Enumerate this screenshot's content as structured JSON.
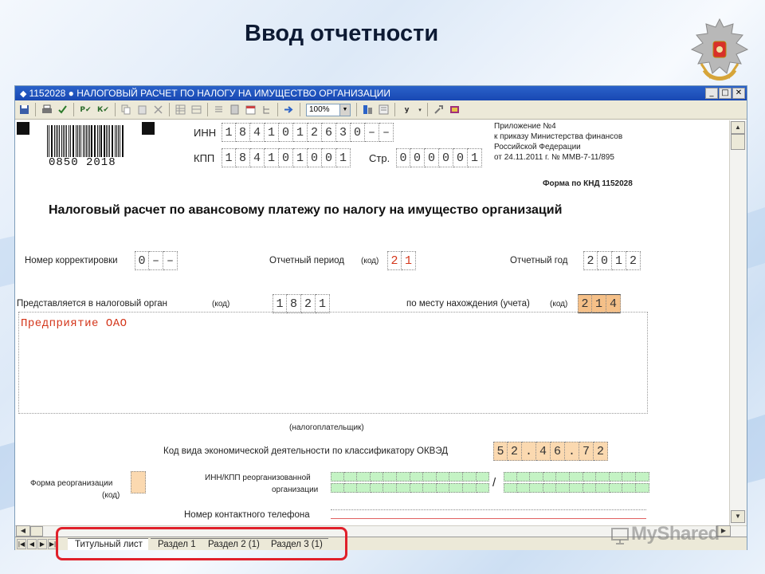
{
  "slide": {
    "title": "Ввод отчетности",
    "watermark": "MyShared"
  },
  "window": {
    "title": "1152028 ● НАЛОГОВЫЙ РАСЧЕТ ПО НАЛОГУ НА ИМУЩЕСТВО ОРГАНИЗАЦИИ",
    "buttons": [
      "_",
      "□",
      "✕"
    ],
    "zoom": "100%"
  },
  "toolbar": {
    "items": [
      "save-icon",
      "print-icon",
      "check-icon",
      "Р✔",
      "К✔",
      "copy-icon",
      "paste-icon",
      "delete-icon",
      "table-icon",
      "arrow-right-icon",
      "filter-icon",
      "у",
      "settings-icon",
      "book-icon"
    ],
    "text_buttons": [
      "Р✔",
      "К✔",
      "у"
    ]
  },
  "form": {
    "barcode_number": "0850 2018",
    "inn_label": "ИНН",
    "inn_cells": [
      "1",
      "8",
      "4",
      "1",
      "0",
      "1",
      "2",
      "6",
      "3",
      "0",
      "–",
      "–"
    ],
    "kpp_label": "КПП",
    "kpp_cells": [
      "1",
      "8",
      "4",
      "1",
      "0",
      "1",
      "0",
      "0",
      "1"
    ],
    "page_label": "Стр.",
    "page_cells": [
      "0",
      "0",
      "0",
      "0",
      "0",
      "1"
    ],
    "appendix": [
      "Приложение №4",
      "к приказу Министерства финансов",
      "Российской Федерации",
      "от 24.11.2011 г. № ММВ-7-11/895"
    ],
    "form_code": "Форма по КНД 1152028",
    "heading": "Налоговый расчет по авансовому платежу по налогу на имущество организаций",
    "correction_label": "Номер корректировки",
    "correction_cells": [
      "0",
      "–",
      "–"
    ],
    "period_label": "Отчетный период",
    "code_hint": "(код)",
    "period_cells": [
      "2",
      "1"
    ],
    "year_label": "Отчетный год",
    "year_cells": [
      "2",
      "0",
      "1",
      "2"
    ],
    "tax_office_label": "Представляется в налоговый орган",
    "tax_office_cells": [
      "1",
      "8",
      "2",
      "1"
    ],
    "location_label": "по месту нахождения (учета)",
    "location_cells": [
      "2",
      "1",
      "4"
    ],
    "org_name": "Предприятие ОАО",
    "taxpayer_caption": "(налогоплательщик)",
    "okved_label": "Код вида экономической деятельности по классификатору ОКВЭД",
    "okved_cells": [
      "5",
      "2",
      ".",
      "4",
      "6",
      ".",
      "7",
      "2"
    ],
    "reorg_label_1": "Форма реорганизации",
    "reorg_label_2": "(код)",
    "reorg_inn_label_1": "ИНН/КПП реорганизованной",
    "reorg_inn_label_2": "организации",
    "phone_label": "Номер контактного телефона"
  },
  "sheets": [
    {
      "label": "Титульный лист",
      "active": true
    },
    {
      "label": "Раздел 1",
      "active": false
    },
    {
      "label": "Раздел 2 (1)",
      "active": false
    },
    {
      "label": "Раздел 3 (1)",
      "active": false
    }
  ],
  "colors": {
    "accent_red": "#d4361b",
    "cell_orange": "#fbd9b0",
    "cell_green": "#c4f3c4",
    "titlebar_blue": "#1948b3",
    "highlight_red": "#e0202a"
  }
}
